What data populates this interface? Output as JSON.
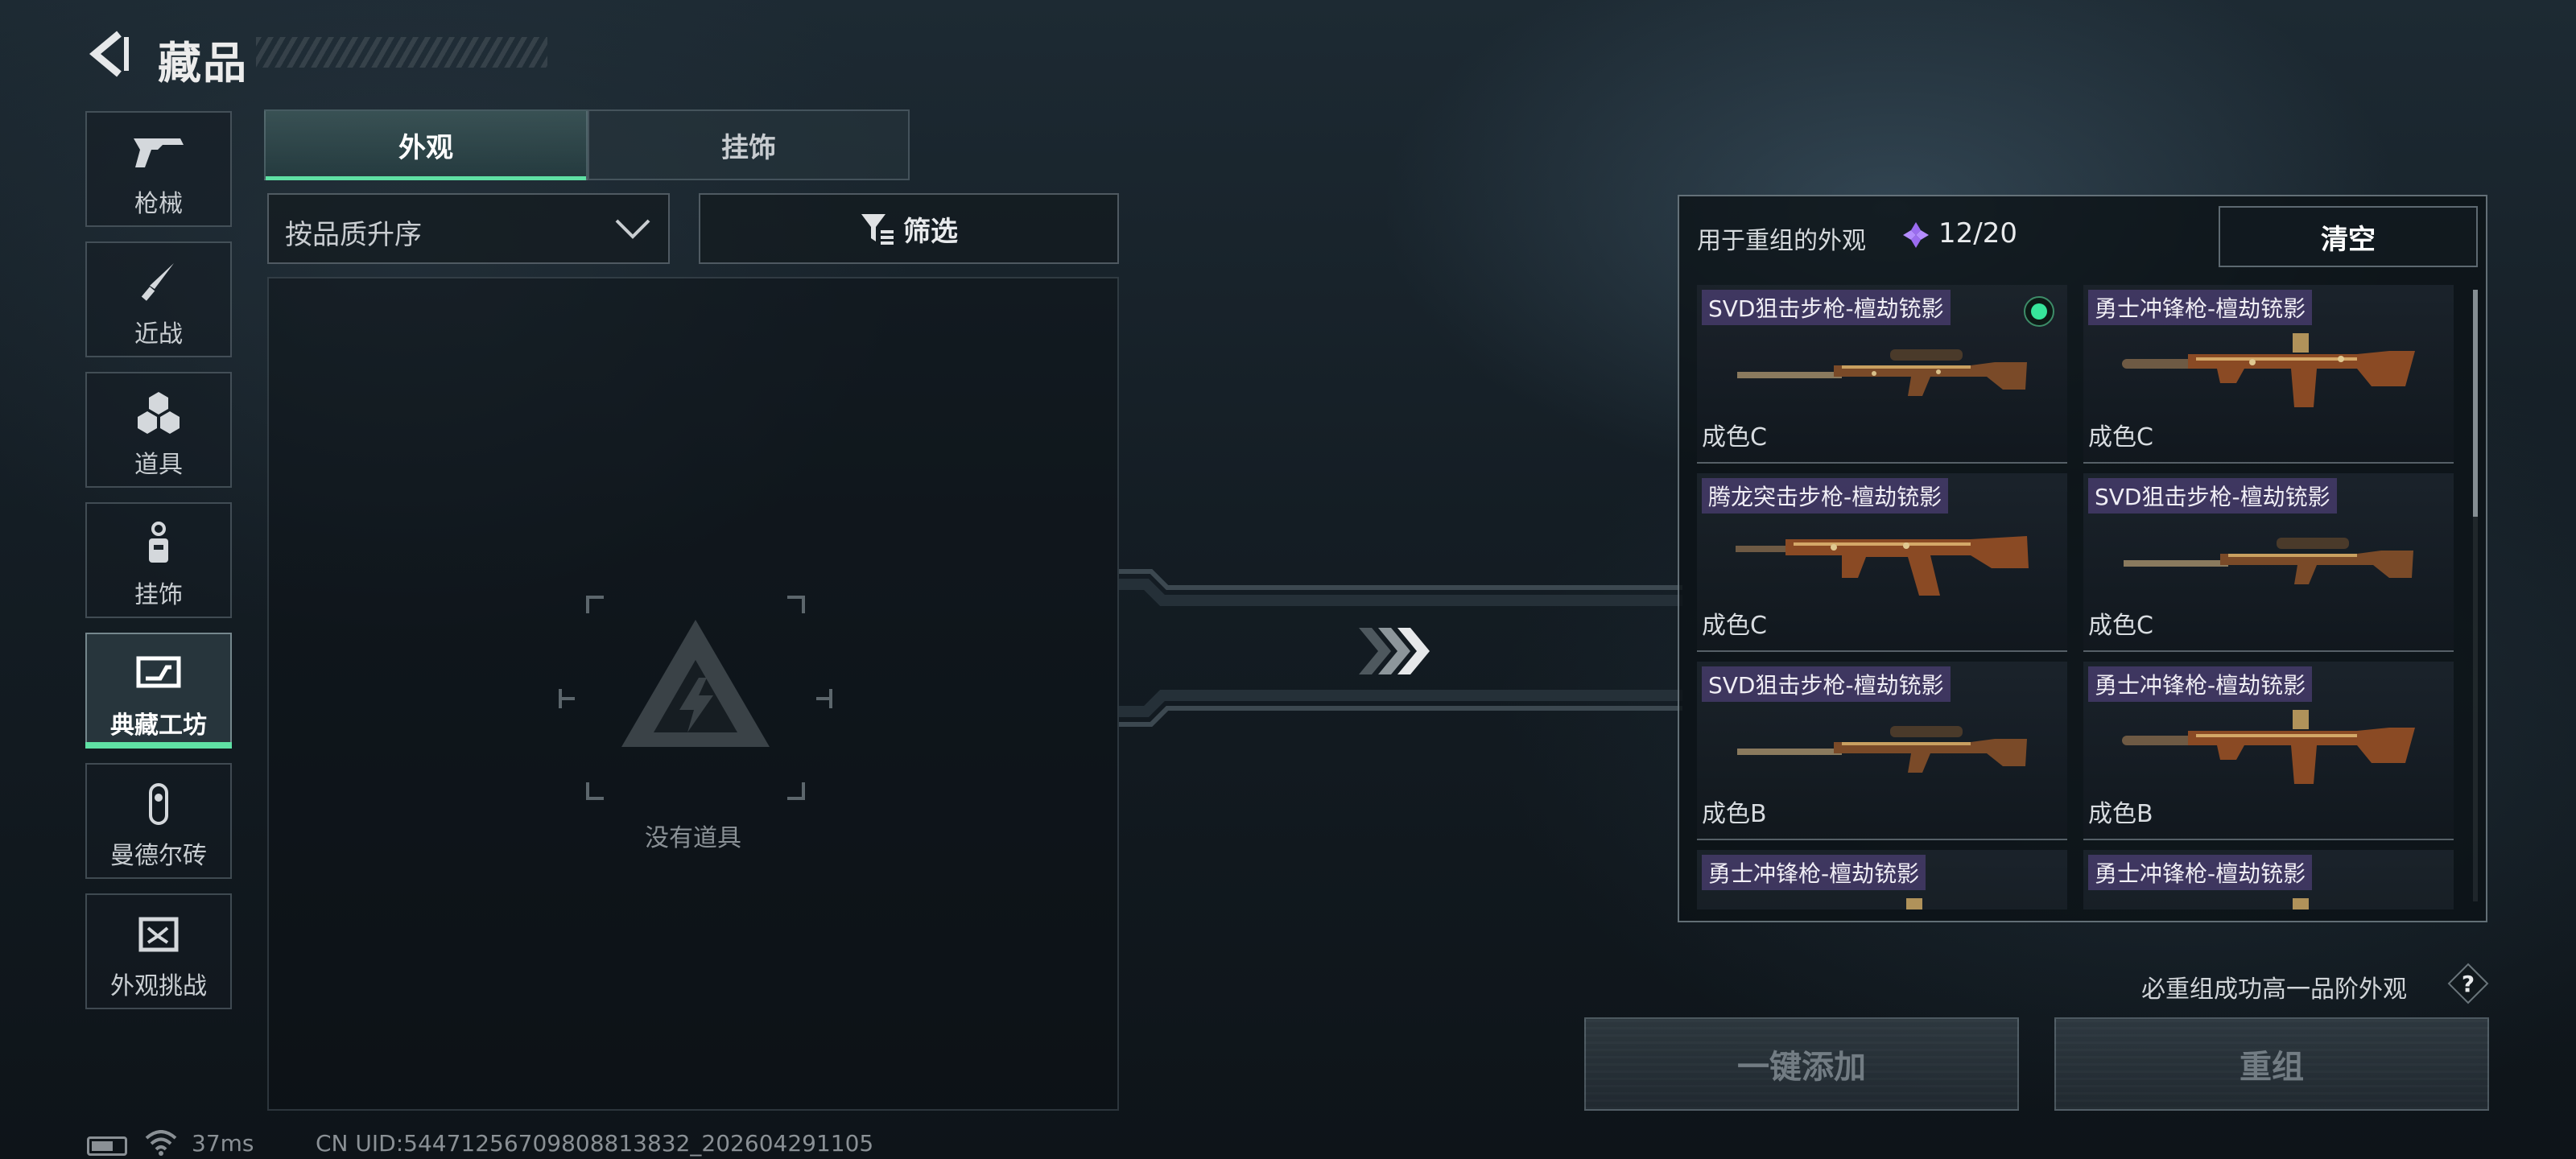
{
  "header": {
    "title": "藏品",
    "back_icon": "back-arrow-icon"
  },
  "nav": {
    "items": [
      {
        "label": "枪械",
        "icon": "pistol-icon"
      },
      {
        "label": "近战",
        "icon": "knife-icon"
      },
      {
        "label": "道具",
        "icon": "grenades-icon"
      },
      {
        "label": "挂饰",
        "icon": "charm-icon"
      },
      {
        "label": "典藏工坊",
        "icon": "workshop-icon",
        "active": true
      },
      {
        "label": "曼德尔砖",
        "icon": "brick-icon"
      },
      {
        "label": "外观挑战",
        "icon": "challenge-icon"
      }
    ]
  },
  "tabs": [
    {
      "label": "外观",
      "active": true
    },
    {
      "label": "挂饰",
      "active": false
    }
  ],
  "sort": {
    "value": "按品质升序"
  },
  "filter": {
    "label": "筛选"
  },
  "left_panel": {
    "empty_text": "没有道具"
  },
  "recombine": {
    "label": "用于重组的外观",
    "count": "12/20",
    "clear_label": "清空",
    "items": [
      {
        "name": "SVD狙击步枪-檀劫铳影",
        "quality": "成色C",
        "selected": true,
        "gun": "sniper"
      },
      {
        "name": "勇士冲锋枪-檀劫铳影",
        "quality": "成色C",
        "selected": false,
        "gun": "smg"
      },
      {
        "name": "腾龙突击步枪-檀劫铳影",
        "quality": "成色C",
        "selected": false,
        "gun": "rifle"
      },
      {
        "name": "SVD狙击步枪-檀劫铳影",
        "quality": "成色C",
        "selected": false,
        "gun": "sniper"
      },
      {
        "name": "SVD狙击步枪-檀劫铳影",
        "quality": "成色B",
        "selected": false,
        "gun": "sniper"
      },
      {
        "name": "勇士冲锋枪-檀劫铳影",
        "quality": "成色B",
        "selected": false,
        "gun": "smg"
      },
      {
        "name": "勇士冲锋枪-檀劫铳影",
        "quality": "",
        "selected": false,
        "gun": "smg"
      },
      {
        "name": "勇士冲锋枪-檀劫铳影",
        "quality": "",
        "selected": false,
        "gun": "smg"
      }
    ]
  },
  "hint": "必重组成功高一品阶外观",
  "buttons": {
    "add_all": "一键添加",
    "recombine": "重组"
  },
  "status": {
    "ping": "37ms",
    "uid": "CN UID:5447125670980881383​2_202604291105"
  },
  "colors": {
    "accent": "#5fe0a4",
    "name_tag": "#5c488c",
    "gem": "#9b6cf0"
  }
}
